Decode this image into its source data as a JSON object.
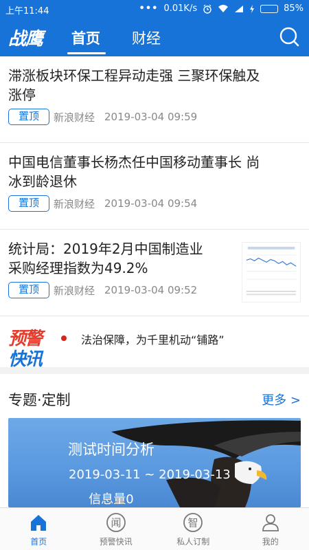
{
  "status_bar": {
    "time": "上午11:44",
    "dots": "•••",
    "network_speed": "0.01K/s",
    "battery_text": "85%",
    "battery_level": 0.85
  },
  "header": {
    "logo": "战鹰",
    "tabs": [
      {
        "label": "首页",
        "active": true
      },
      {
        "label": "财经",
        "active": false
      }
    ],
    "search_icon": "search-icon"
  },
  "news": [
    {
      "title_line1": "滞涨板块环保工程异动走强 三聚环保触及",
      "title_line2": "涨停",
      "badge": "置顶",
      "source": "新浪财经",
      "time": "2019-03-04 09:59"
    },
    {
      "title_line1": "中国电信董事长杨杰任中国移动董事长 尚",
      "title_line2": "冰到龄退休",
      "badge": "置顶",
      "source": "新浪财经",
      "time": "2019-03-04 09:54"
    },
    {
      "title_line1": "统计局：2019年2月中国制造业",
      "title_line2": "采购经理指数为49.2%",
      "badge": "置顶",
      "source": "新浪财经",
      "time": "2019-03-04 09:52",
      "thumbnail": "pmi-chart-thumbnail"
    }
  ],
  "alert": {
    "logo_line1": "预警",
    "logo_line2": "快讯",
    "text": "法治保障，为千里机动“铺路”"
  },
  "topic": {
    "title": "专题·定制",
    "more": "更多 >",
    "banner": {
      "title": "测试时间分析",
      "date_range": "2019-03-11 ~ 2019-03-13",
      "count": "信息量0"
    }
  },
  "bottom_nav": [
    {
      "label": "首页",
      "icon": "home-icon",
      "active": true
    },
    {
      "label": "预警快讯",
      "icon": "alert-news-icon",
      "glyph": "闻",
      "active": false
    },
    {
      "label": "私人订制",
      "icon": "custom-icon",
      "glyph": "智",
      "active": false
    },
    {
      "label": "我的",
      "icon": "profile-icon",
      "active": false
    }
  ],
  "colors": {
    "primary": "#1873d8",
    "alert_red": "#e53b2c"
  }
}
